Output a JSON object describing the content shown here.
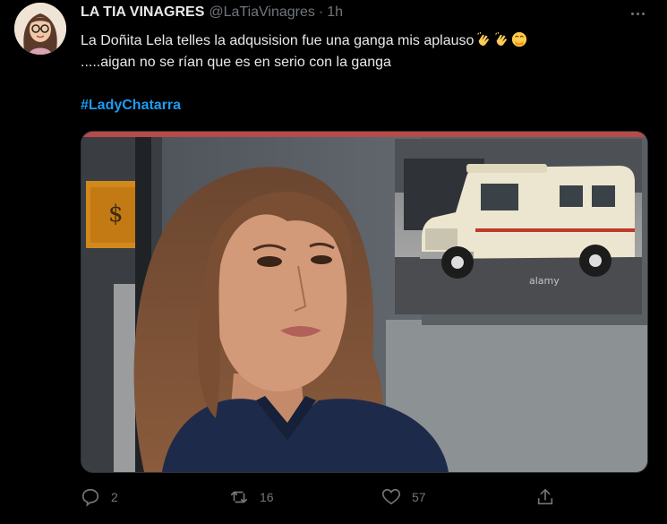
{
  "author": {
    "display_name": "LA TIA VINAGRES",
    "handle": "@LaTiaVinagres",
    "separator": "·",
    "time": "1h"
  },
  "tweet": {
    "line1": "La Doñita Lela telles la adqusision fue una ganga mis aplauso",
    "line2": ".....aigan no se rían que es en serio  con la ganga",
    "hashtag": "#LadyChatarra",
    "emojis": [
      "clapping-hands",
      "clapping-hands",
      "hand-over-mouth"
    ]
  },
  "media": {
    "description_icons": [
      "woman-portrait",
      "vintage-ambulance"
    ],
    "watermark": "alamy"
  },
  "actions": {
    "replies": "2",
    "retweets": "16",
    "likes": "57"
  },
  "colors": {
    "background": "#000000",
    "text": "#e7e9ea",
    "muted": "#71767b",
    "link": "#1d9bf0"
  }
}
